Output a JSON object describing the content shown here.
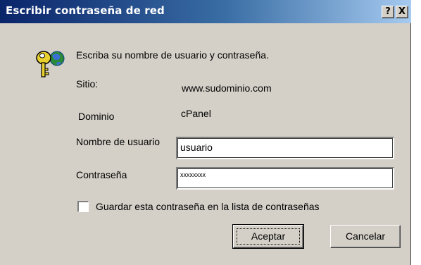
{
  "window": {
    "title": "Escribir contraseña de red",
    "help_label": "?",
    "close_label": "X"
  },
  "dialog": {
    "instruction": "Escriba su nombre de usuario y contraseña.",
    "site_label": "Sitio:",
    "site_value": "www.sudominio.com",
    "domain_label": "Dominio",
    "domain_value": "cPanel",
    "username_label": "Nombre de usuario",
    "username_value": "usuario",
    "password_label": "Contraseña",
    "password_value": "xxxxxxxx",
    "save_password_label": "Guardar esta contraseña en la lista de contraseñas",
    "save_password_checked": false,
    "ok_label": "Aceptar",
    "cancel_label": "Cancelar",
    "icon": "key-globe-icon"
  },
  "colors": {
    "title_gradient_start": "#0a246a",
    "title_gradient_end": "#a6caf0",
    "dialog_background": "#d4d0c8"
  }
}
